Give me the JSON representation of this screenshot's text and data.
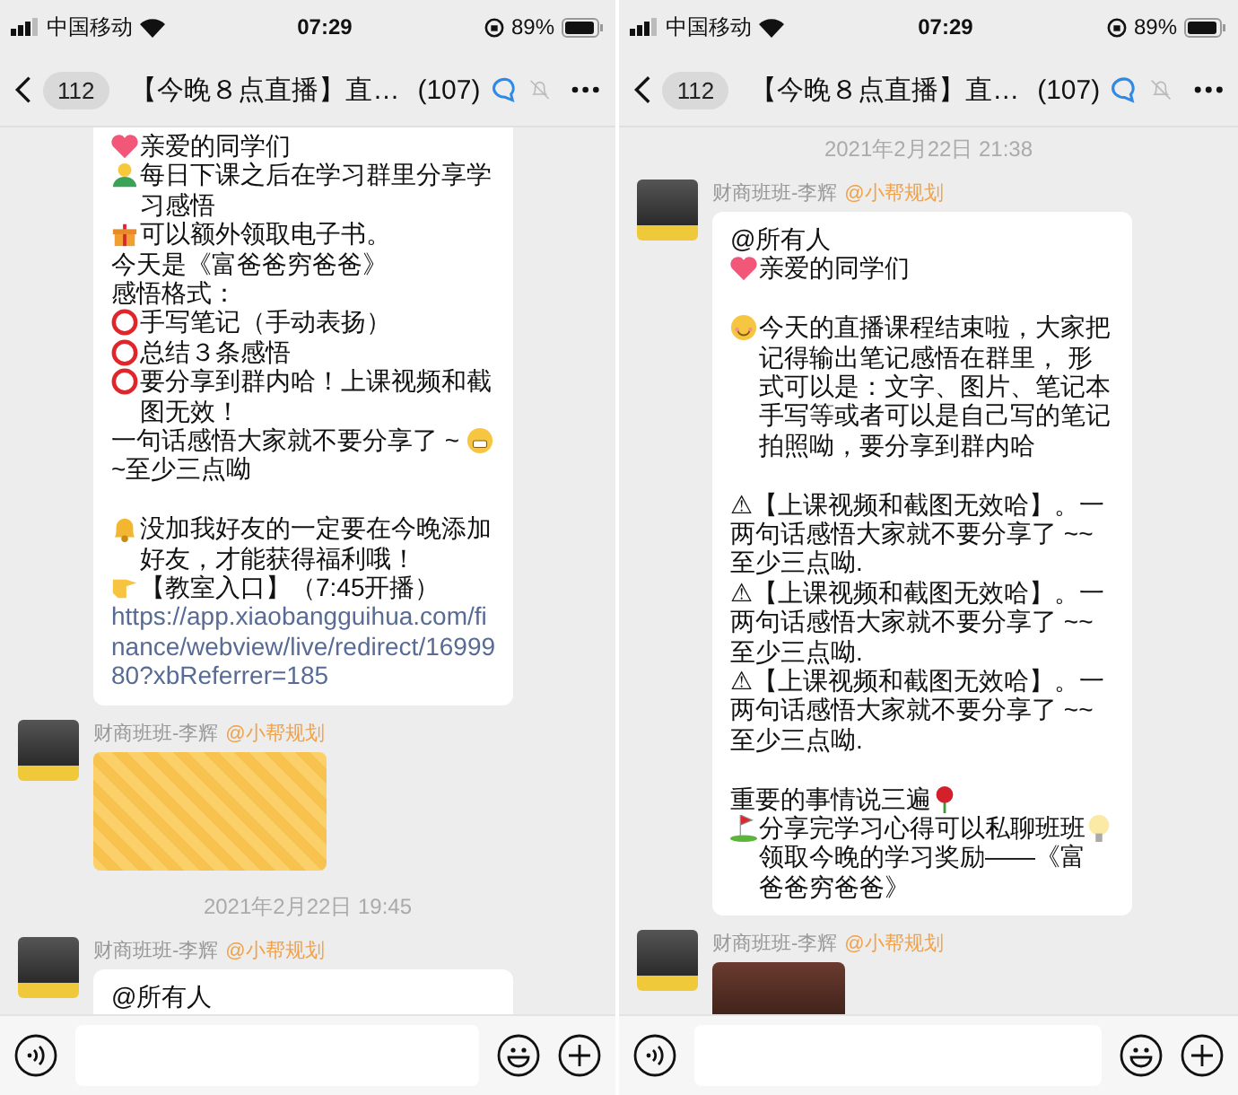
{
  "panels": [
    {
      "status": {
        "carrier": "中国移动",
        "time": "07:29",
        "battery": "89%"
      },
      "header": {
        "back_count": "112",
        "title": "【今晚８点直播】直…",
        "member_count": "(107)"
      },
      "messages": [
        {
          "kind": "continued_text",
          "paragraphs": [
            [
              {
                "kind": "text",
                "text": "亲爱的同学们"
              },
              {
                "kind": "text",
                "text": "每日下课之后在学习群里分享学习感悟"
              },
              {
                "kind": "text",
                "text": "可以额外领取电子书。"
              },
              {
                "kind": "text",
                "text": "今天是《富爸爸穷爸爸》"
              },
              {
                "kind": "text",
                "text": "感悟格式："
              },
              {
                "kind": "text",
                "text": "手写笔记（手动表扬）"
              },
              {
                "kind": "text",
                "text": "总结３条感悟"
              },
              {
                "kind": "text",
                "text": "要分享到群内哈！上课视频和截图无效！"
              },
              {
                "kind": "text",
                "text": "一句话感悟大家就不要分享了 ~~至少三点呦"
              }
            ],
            [
              {
                "kind": "text",
                "text": "没加我好友的一定要在今晚添加好友，才能获得福利哦！"
              },
              {
                "kind": "text",
                "text": "【教室入口】（7:45开播）"
              },
              {
                "kind": "link",
                "text": "https://app.xiaobangguihua.com/finance/webview/live/redirect/1699980?xbReferrer=185"
              }
            ]
          ]
        },
        {
          "kind": "image",
          "sender": "财商班班-李辉",
          "mention": "@小帮规划"
        },
        {
          "kind": "timestamp",
          "text": "2021年2月22日 19:45"
        },
        {
          "kind": "text",
          "sender": "财商班班-李辉",
          "mention": "@小帮规划",
          "paragraphs": [
            [
              {
                "kind": "text",
                "text": "@所有人"
              }
            ]
          ]
        }
      ]
    },
    {
      "status": {
        "carrier": "中国移动",
        "time": "07:29",
        "battery": "89%"
      },
      "header": {
        "back_count": "112",
        "title": "【今晚８点直播】直…",
        "member_count": "(107)"
      },
      "messages": [
        {
          "kind": "timestamp",
          "text": "2021年2月22日 21:38"
        },
        {
          "kind": "text",
          "sender": "财商班班-李辉",
          "mention": "@小帮规划",
          "paragraphs": [
            [
              {
                "kind": "text",
                "text": "@所有人"
              },
              {
                "kind": "text",
                "text": "亲爱的同学们"
              }
            ],
            [
              {
                "kind": "text",
                "text": "今天的直播课程结束啦，大家把记得输出笔记感悟在群里， 形式可以是：文字、图片、笔记本手写等或者可以是自己写的笔记拍照呦，要分享到群内哈"
              }
            ],
            [
              {
                "kind": "text",
                "text": "⚠【上课视频和截图无效哈】。一两句话感悟大家就不要分享了 ~~至少三点呦."
              },
              {
                "kind": "text",
                "text": "⚠【上课视频和截图无效哈】。一两句话感悟大家就不要分享了 ~~至少三点呦."
              },
              {
                "kind": "text",
                "text": "⚠【上课视频和截图无效哈】。一两句话感悟大家就不要分享了 ~~至少三点呦."
              }
            ],
            [
              {
                "kind": "text",
                "text": "重要的事情说三遍"
              },
              {
                "kind": "text",
                "text": "分享完学习心得可以私聊班班领取今晚的学习奖励——《富爸爸穷爸爸》"
              }
            ]
          ]
        },
        {
          "kind": "video",
          "sender": "财商班班-李辉",
          "mention": "@小帮规划"
        }
      ]
    }
  ]
}
